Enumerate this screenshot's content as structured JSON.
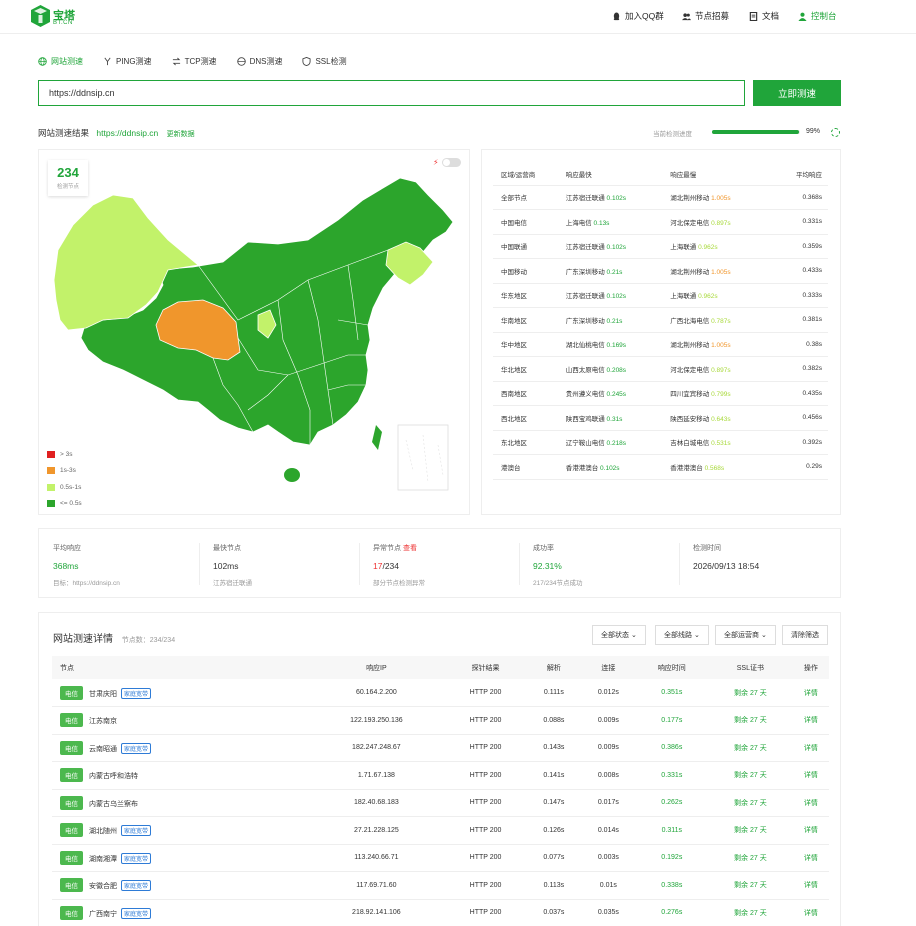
{
  "header": {
    "logo_main": "宝塔",
    "logo_sub": "BT.CN",
    "nav": [
      {
        "label": "加入QQ群",
        "icon": "qq-icon"
      },
      {
        "label": "节点招募",
        "icon": "users-icon"
      },
      {
        "label": "文档",
        "icon": "doc-icon"
      },
      {
        "label": "控制台",
        "icon": "user-icon"
      }
    ]
  },
  "tabs": [
    {
      "label": "网站测速",
      "icon": "globe-icon",
      "active": true
    },
    {
      "label": "PING测速",
      "icon": "ping-icon",
      "active": false
    },
    {
      "label": "TCP测速",
      "icon": "tcp-icon",
      "active": false
    },
    {
      "label": "DNS测速",
      "icon": "dns-icon",
      "active": false
    },
    {
      "label": "SSL检测",
      "icon": "shield-icon",
      "active": false
    }
  ],
  "search": {
    "value": "https://ddnsip.cn",
    "button": "立即测速"
  },
  "result": {
    "title": "网站测速结果",
    "url": "https://ddnsip.cn",
    "update": "更新数据",
    "progress_label": "当前检测进度",
    "progress_pct": 0.99,
    "progress_text": "99%"
  },
  "map": {
    "count": "234",
    "count_label": "检测节点",
    "legend": [
      {
        "label": "> 3s",
        "color": "#e02020"
      },
      {
        "label": "1s-3s",
        "color": "#f0962c"
      },
      {
        "label": "0.5s-1s",
        "color": "#c2f26a"
      },
      {
        "label": "<= 0.5s",
        "color": "#2ca52c"
      }
    ]
  },
  "region_table": {
    "headers": [
      "区域/运营商",
      "响应最快",
      "响应最慢",
      "平均响应"
    ],
    "rows": [
      {
        "region": "全部节点",
        "fast": "江苏宿迁联通",
        "fast_t": "0.102s",
        "slow": "湖北荆州移动",
        "slow_t": "1.005s",
        "slow_c": "o",
        "avg": "0.368s"
      },
      {
        "region": "中国电信",
        "fast": "上海电信",
        "fast_t": "0.13s",
        "slow": "河北保定电信",
        "slow_t": "0.897s",
        "slow_c": "lg",
        "avg": "0.331s"
      },
      {
        "region": "中国联通",
        "fast": "江苏宿迁联通",
        "fast_t": "0.102s",
        "slow": "上海联通",
        "slow_t": "0.962s",
        "slow_c": "lg",
        "avg": "0.359s"
      },
      {
        "region": "中国移动",
        "fast": "广东深圳移动",
        "fast_t": "0.21s",
        "slow": "湖北荆州移动",
        "slow_t": "1.005s",
        "slow_c": "o",
        "avg": "0.433s"
      },
      {
        "region": "华东地区",
        "fast": "江苏宿迁联通",
        "fast_t": "0.102s",
        "slow": "上海联通",
        "slow_t": "0.962s",
        "slow_c": "lg",
        "avg": "0.333s"
      },
      {
        "region": "华南地区",
        "fast": "广东深圳移动",
        "fast_t": "0.21s",
        "slow": "广西北海电信",
        "slow_t": "0.787s",
        "slow_c": "lg",
        "avg": "0.381s"
      },
      {
        "region": "华中地区",
        "fast": "湖北仙桃电信",
        "fast_t": "0.169s",
        "slow": "湖北荆州移动",
        "slow_t": "1.005s",
        "slow_c": "o",
        "avg": "0.38s"
      },
      {
        "region": "华北地区",
        "fast": "山西太原电信",
        "fast_t": "0.208s",
        "slow": "河北保定电信",
        "slow_t": "0.897s",
        "slow_c": "lg",
        "avg": "0.382s"
      },
      {
        "region": "西南地区",
        "fast": "贵州遵义电信",
        "fast_t": "0.245s",
        "slow": "四川宜宾移动",
        "slow_t": "0.799s",
        "slow_c": "lg",
        "avg": "0.435s"
      },
      {
        "region": "西北地区",
        "fast": "陕西宝鸡联通",
        "fast_t": "0.31s",
        "slow": "陕西延安移动",
        "slow_t": "0.643s",
        "slow_c": "lg",
        "avg": "0.456s"
      },
      {
        "region": "东北地区",
        "fast": "辽宁鞍山电信",
        "fast_t": "0.218s",
        "slow": "吉林白城电信",
        "slow_t": "0.531s",
        "slow_c": "lg",
        "avg": "0.392s"
      },
      {
        "region": "港澳台",
        "fast": "香港港澳台",
        "fast_t": "0.102s",
        "slow": "香港港澳台",
        "slow_t": "0.568s",
        "slow_c": "lg",
        "avg": "0.29s"
      }
    ]
  },
  "stats": [
    {
      "key": "平均响应",
      "value": "368ms",
      "sub": "目标：https://ddnsip.cn"
    },
    {
      "key": "最快节点",
      "value": "102ms",
      "sub": "江苏宿迁联通"
    },
    {
      "key": "异常节点",
      "link": "查看",
      "value_red": "17",
      "value_rest": "/234",
      "sub": "部分节点检测异常"
    },
    {
      "key": "成功率",
      "value": "92.31%",
      "sub": "217/234节点成功"
    },
    {
      "key": "检测时间",
      "value": "2026/09/13 18:54",
      "sub": ""
    }
  ],
  "detail": {
    "title": "网站测速详情",
    "count": "节点数：234/234",
    "filters": [
      "全部状态",
      "全部线路",
      "全部运营商",
      "清除筛选"
    ],
    "headers": [
      "节点",
      "响应IP",
      "探针结果",
      "解析",
      "连接",
      "响应时间",
      "SSL证书",
      "操作"
    ],
    "rows": [
      {
        "isp": "电信",
        "node": "甘肃庆阳",
        "tag": "家庭宽带",
        "ip": "60.164.2.200",
        "result": "HTTP 200",
        "dns": "0.111s",
        "conn": "0.012s",
        "resp": "0.351s",
        "ssl": "剩余 27 天",
        "op": "详情"
      },
      {
        "isp": "电信",
        "node": "江苏南京",
        "tag": "",
        "ip": "122.193.250.136",
        "result": "HTTP 200",
        "dns": "0.088s",
        "conn": "0.009s",
        "resp": "0.177s",
        "ssl": "剩余 27 天",
        "op": "详情"
      },
      {
        "isp": "电信",
        "node": "云南昭通",
        "tag": "家庭宽带",
        "ip": "182.247.248.67",
        "result": "HTTP 200",
        "dns": "0.143s",
        "conn": "0.009s",
        "resp": "0.386s",
        "ssl": "剩余 27 天",
        "op": "详情"
      },
      {
        "isp": "电信",
        "node": "内蒙古呼和浩特",
        "tag": "",
        "ip": "1.71.67.138",
        "result": "HTTP 200",
        "dns": "0.141s",
        "conn": "0.008s",
        "resp": "0.331s",
        "ssl": "剩余 27 天",
        "op": "详情"
      },
      {
        "isp": "电信",
        "node": "内蒙古乌兰察布",
        "tag": "",
        "ip": "182.40.68.183",
        "result": "HTTP 200",
        "dns": "0.147s",
        "conn": "0.017s",
        "resp": "0.262s",
        "ssl": "剩余 27 天",
        "op": "详情"
      },
      {
        "isp": "电信",
        "node": "湖北随州",
        "tag": "家庭宽带",
        "ip": "27.21.228.125",
        "result": "HTTP 200",
        "dns": "0.126s",
        "conn": "0.014s",
        "resp": "0.311s",
        "ssl": "剩余 27 天",
        "op": "详情"
      },
      {
        "isp": "电信",
        "node": "湖南湘潭",
        "tag": "家庭宽带",
        "ip": "113.240.66.71",
        "result": "HTTP 200",
        "dns": "0.077s",
        "conn": "0.003s",
        "resp": "0.192s",
        "ssl": "剩余 27 天",
        "op": "详情"
      },
      {
        "isp": "电信",
        "node": "安徽合肥",
        "tag": "家庭宽带",
        "ip": "117.69.71.60",
        "result": "HTTP 200",
        "dns": "0.113s",
        "conn": "0.01s",
        "resp": "0.338s",
        "ssl": "剩余 27 天",
        "op": "详情"
      },
      {
        "isp": "电信",
        "node": "广西南宁",
        "tag": "家庭宽带",
        "ip": "218.92.141.106",
        "result": "HTTP 200",
        "dns": "0.037s",
        "conn": "0.035s",
        "resp": "0.276s",
        "ssl": "剩余 27 天",
        "op": "详情"
      }
    ]
  }
}
